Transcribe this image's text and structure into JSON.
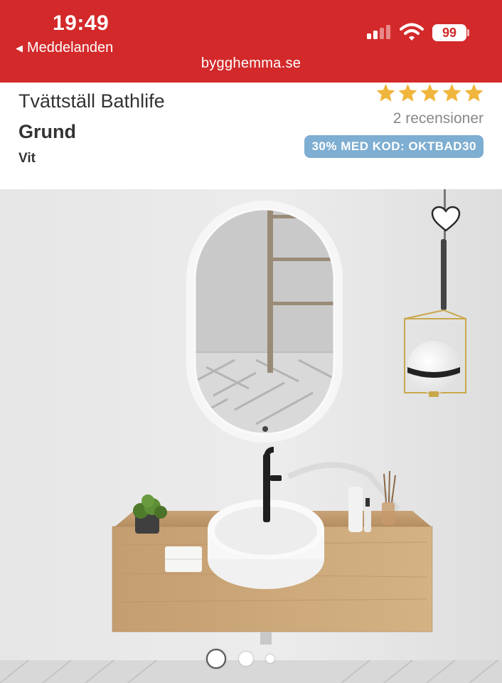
{
  "status_bar": {
    "time": "19:49",
    "back_label": "Meddelanden",
    "battery": "99",
    "signal_icon": "signal-icon",
    "wifi_icon": "wifi-icon"
  },
  "browser": {
    "url": "bygghemma.se"
  },
  "product": {
    "title": "Tvättställ Bathlife",
    "variant": "Grund",
    "color": "Vit",
    "rating": 5,
    "rating_max": 5,
    "reviews": "2 recensioner",
    "promo": "30% MED KOD: OKTBAD30"
  },
  "gallery": {
    "current_image": 1,
    "image_count": 3,
    "favorite_icon": "heart-icon"
  },
  "colors": {
    "brand_red": "#d3292a",
    "star": "#f0b53c",
    "promo_bg": "#7eaed1"
  }
}
